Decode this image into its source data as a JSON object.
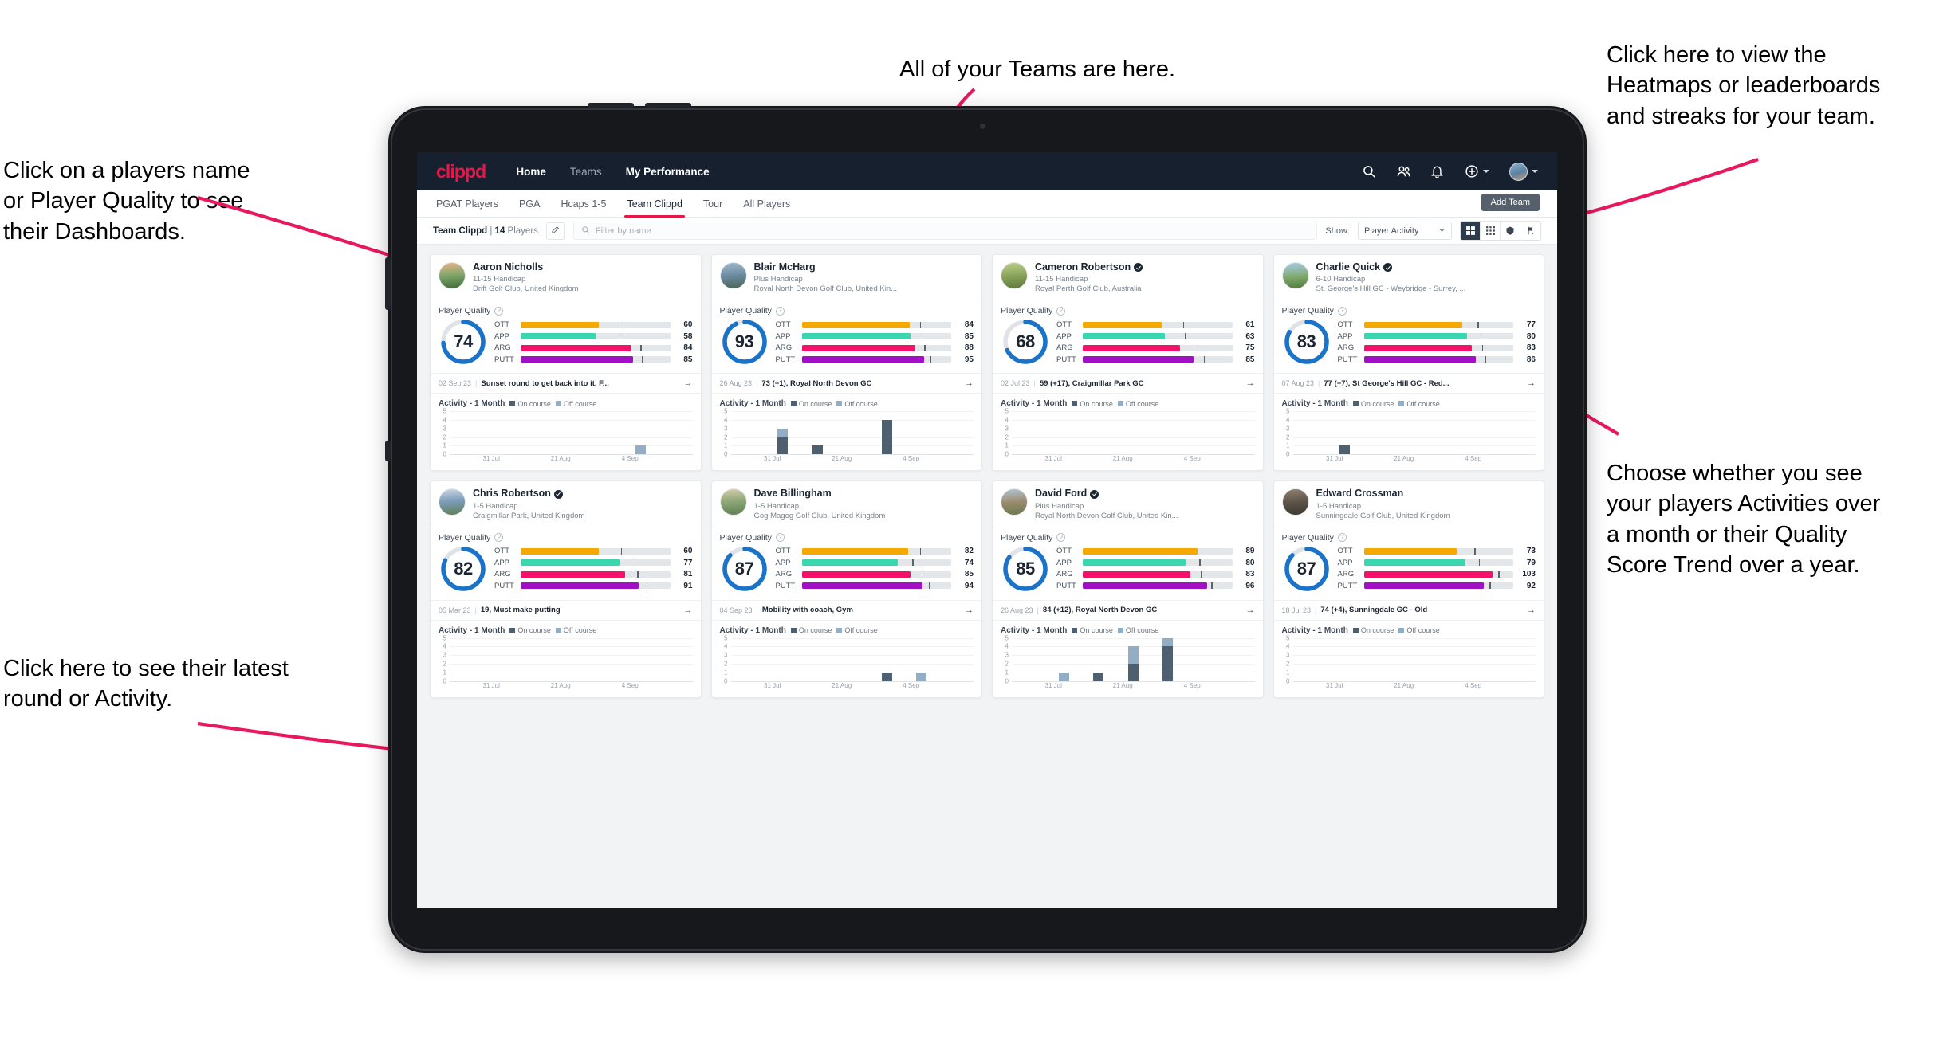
{
  "annotations": [
    {
      "id": "a-teams",
      "text": "All of your Teams are here."
    },
    {
      "id": "a-heatmaps",
      "text": "Click here to view the\nHeatmaps or leaderboards\nand streaks for your team."
    },
    {
      "id": "a-names",
      "text": "Click on a players name\nor Player Quality to see\ntheir Dashboards."
    },
    {
      "id": "a-activity",
      "text": "Choose whether you see\nyour players Activities over\na month or their Quality\nScore Trend over a year."
    },
    {
      "id": "a-latest",
      "text": "Click here to see their latest\nround or Activity."
    }
  ],
  "topnav": {
    "brand": "clippd",
    "links": [
      {
        "label": "Home",
        "active": true
      },
      {
        "label": "Teams",
        "active": false
      },
      {
        "label": "My Performance",
        "active": true
      }
    ],
    "icons": [
      "search-icon",
      "people-icon",
      "bell-icon",
      "plus-circle-icon"
    ],
    "avatar": "user-avatar"
  },
  "tabs": [
    {
      "label": "PGAT Players",
      "active": false
    },
    {
      "label": "PGA",
      "active": false
    },
    {
      "label": "Hcaps 1-5",
      "active": false
    },
    {
      "label": "Team Clippd",
      "active": true
    },
    {
      "label": "Tour",
      "active": false
    },
    {
      "label": "All Players",
      "active": false
    }
  ],
  "add_team_label": "Add Team",
  "toolbar": {
    "team_name": "Team Clippd",
    "separator": "|",
    "player_count": "14",
    "players_word": "Players",
    "edit_icon": "pencil-icon",
    "search_placeholder": "Filter by name",
    "show_label": "Show:",
    "show_value": "Player Activity",
    "views": [
      {
        "name": "view-cards",
        "icon": "grid-large-icon",
        "active": true
      },
      {
        "name": "view-compact",
        "icon": "grid-small-icon",
        "active": false
      },
      {
        "name": "view-heatmap",
        "icon": "shield-icon",
        "active": false
      },
      {
        "name": "view-leaderboard",
        "icon": "flag-icon",
        "active": false
      }
    ]
  },
  "card_labels": {
    "player_quality": "Player Quality",
    "activity": "Activity - 1 Month",
    "legend_on": "On course",
    "legend_off": "Off course",
    "arrow": "→"
  },
  "colors": {
    "brand": "#e8174b",
    "navy": "#16202e",
    "donut": "#1a73c8",
    "ott": "#f5a800",
    "app": "#3ad6b0",
    "arg": "#f5106a",
    "putt": "#a210c6",
    "on_course": "#4e606f",
    "off_course": "#93aec4"
  },
  "chart_data": {
    "type": "bar",
    "title": "Activity - 1 Month",
    "ylabel": "",
    "xlabel": "",
    "ylim": [
      0,
      5
    ],
    "yticks": [
      0,
      1,
      2,
      3,
      4,
      5
    ],
    "xticks": [
      "31 Jul",
      "21 Aug",
      "4 Sep"
    ],
    "stacked": true,
    "series_names": [
      "On course",
      "Off course"
    ],
    "grid": true,
    "legend_position": "top"
  },
  "players": [
    {
      "name": "Aaron Nicholls",
      "verified": false,
      "handicap": "11-15 Handicap",
      "club": "Drift Golf Club, United Kingdom",
      "quality": 74,
      "skills": [
        {
          "label": "OTT",
          "value": 60,
          "fill": 52,
          "mark": 66
        },
        {
          "label": "APP",
          "value": 58,
          "fill": 50,
          "mark": 66
        },
        {
          "label": "ARG",
          "value": 84,
          "fill": 74,
          "mark": 80
        },
        {
          "label": "PUTT",
          "value": 85,
          "fill": 75,
          "mark": 81
        }
      ],
      "round": {
        "date": "02 Sep 23",
        "text": "Sunset round to get back into it, F..."
      },
      "activity": {
        "on": [
          0,
          0,
          0,
          0,
          0,
          0,
          0
        ],
        "off": [
          0,
          0,
          0,
          0,
          0,
          1,
          0
        ]
      }
    },
    {
      "name": "Blair McHarg",
      "verified": false,
      "handicap": "Plus Handicap",
      "club": "Royal North Devon Golf Club, United Kin...",
      "quality": 93,
      "skills": [
        {
          "label": "OTT",
          "value": 84,
          "fill": 72,
          "mark": 79
        },
        {
          "label": "APP",
          "value": 85,
          "fill": 73,
          "mark": 80
        },
        {
          "label": "ARG",
          "value": 88,
          "fill": 76,
          "mark": 82
        },
        {
          "label": "PUTT",
          "value": 95,
          "fill": 82,
          "mark": 86
        }
      ],
      "round": {
        "date": "26 Aug 23",
        "text": "73 (+1), Royal North Devon GC"
      },
      "activity": {
        "on": [
          0,
          2,
          1,
          0,
          0,
          0,
          0
        ],
        "off": [
          0,
          1,
          0,
          0,
          0,
          0,
          0
        ],
        "extra_on": [
          0,
          0,
          0,
          0,
          4,
          0,
          0
        ]
      }
    },
    {
      "name": "Cameron Robertson",
      "verified": true,
      "handicap": "11-15 Handicap",
      "club": "Royal Perth Golf Club, Australia",
      "quality": 68,
      "skills": [
        {
          "label": "OTT",
          "value": 61,
          "fill": 53,
          "mark": 67
        },
        {
          "label": "APP",
          "value": 63,
          "fill": 55,
          "mark": 68
        },
        {
          "label": "ARG",
          "value": 75,
          "fill": 65,
          "mark": 74
        },
        {
          "label": "PUTT",
          "value": 85,
          "fill": 74,
          "mark": 81
        }
      ],
      "round": {
        "date": "02 Jul 23",
        "text": "59 (+17), Craigmillar Park GC"
      },
      "activity": {
        "on": [
          0,
          0,
          0,
          0,
          0,
          0,
          0
        ],
        "off": [
          0,
          0,
          0,
          0,
          0,
          0,
          0
        ]
      }
    },
    {
      "name": "Charlie Quick",
      "verified": true,
      "handicap": "6-10 Handicap",
      "club": "St. George's Hill GC - Weybridge - Surrey, ...",
      "quality": 83,
      "skills": [
        {
          "label": "OTT",
          "value": 77,
          "fill": 66,
          "mark": 76
        },
        {
          "label": "APP",
          "value": 80,
          "fill": 69,
          "mark": 78
        },
        {
          "label": "ARG",
          "value": 83,
          "fill": 72,
          "mark": 79
        },
        {
          "label": "PUTT",
          "value": 86,
          "fill": 75,
          "mark": 81
        }
      ],
      "round": {
        "date": "07 Aug 23",
        "text": "77 (+7), St George's Hill GC - Red..."
      },
      "activity": {
        "on": [
          0,
          1,
          0,
          0,
          0,
          0,
          0
        ],
        "off": [
          0,
          0,
          0,
          0,
          0,
          0,
          0
        ]
      }
    },
    {
      "name": "Chris Robertson",
      "verified": true,
      "handicap": "1-5 Handicap",
      "club": "Craigmillar Park, United Kingdom",
      "quality": 82,
      "skills": [
        {
          "label": "OTT",
          "value": 60,
          "fill": 52,
          "mark": 67
        },
        {
          "label": "APP",
          "value": 77,
          "fill": 66,
          "mark": 76
        },
        {
          "label": "ARG",
          "value": 81,
          "fill": 70,
          "mark": 78
        },
        {
          "label": "PUTT",
          "value": 91,
          "fill": 79,
          "mark": 84
        }
      ],
      "round": {
        "date": "05 Mar 23",
        "text": "19, Must make putting"
      },
      "activity": {
        "on": [
          0,
          0,
          0,
          0,
          0,
          0,
          0
        ],
        "off": [
          0,
          0,
          0,
          0,
          0,
          0,
          0
        ]
      }
    },
    {
      "name": "Dave Billingham",
      "verified": false,
      "handicap": "1-5 Handicap",
      "club": "Gog Magog Golf Club, United Kingdom",
      "quality": 87,
      "skills": [
        {
          "label": "OTT",
          "value": 82,
          "fill": 71,
          "mark": 79
        },
        {
          "label": "APP",
          "value": 74,
          "fill": 64,
          "mark": 74
        },
        {
          "label": "ARG",
          "value": 85,
          "fill": 73,
          "mark": 80
        },
        {
          "label": "PUTT",
          "value": 94,
          "fill": 81,
          "mark": 85
        }
      ],
      "round": {
        "date": "04 Sep 23",
        "text": "Mobility with coach, Gym"
      },
      "activity": {
        "on": [
          0,
          0,
          0,
          0,
          1,
          0,
          0
        ],
        "off": [
          0,
          0,
          0,
          0,
          0,
          1,
          0
        ]
      }
    },
    {
      "name": "David Ford",
      "verified": true,
      "handicap": "Plus Handicap",
      "club": "Royal North Devon Golf Club, United Kin...",
      "quality": 85,
      "skills": [
        {
          "label": "OTT",
          "value": 89,
          "fill": 77,
          "mark": 82
        },
        {
          "label": "APP",
          "value": 80,
          "fill": 69,
          "mark": 78
        },
        {
          "label": "ARG",
          "value": 83,
          "fill": 72,
          "mark": 79
        },
        {
          "label": "PUTT",
          "value": 96,
          "fill": 83,
          "mark": 86
        }
      ],
      "round": {
        "date": "26 Aug 23",
        "text": "84 (+12), Royal North Devon GC"
      },
      "activity": {
        "on": [
          0,
          0,
          1,
          2,
          4,
          0,
          0
        ],
        "off": [
          0,
          1,
          0,
          2,
          1,
          0,
          0
        ]
      }
    },
    {
      "name": "Edward Crossman",
      "verified": false,
      "handicap": "1-5 Handicap",
      "club": "Sunningdale Golf Club, United Kingdom",
      "quality": 87,
      "skills": [
        {
          "label": "OTT",
          "value": 73,
          "fill": 62,
          "mark": 74
        },
        {
          "label": "APP",
          "value": 79,
          "fill": 68,
          "mark": 77
        },
        {
          "label": "ARG",
          "value": 103,
          "fill": 86,
          "mark": 90
        },
        {
          "label": "PUTT",
          "value": 92,
          "fill": 80,
          "mark": 84
        }
      ],
      "round": {
        "date": "18 Jul 23",
        "text": "74 (+4), Sunningdale GC - Old"
      },
      "activity": {
        "on": [
          0,
          0,
          0,
          0,
          0,
          0,
          0
        ],
        "off": [
          0,
          0,
          0,
          0,
          0,
          0,
          0
        ]
      }
    }
  ]
}
